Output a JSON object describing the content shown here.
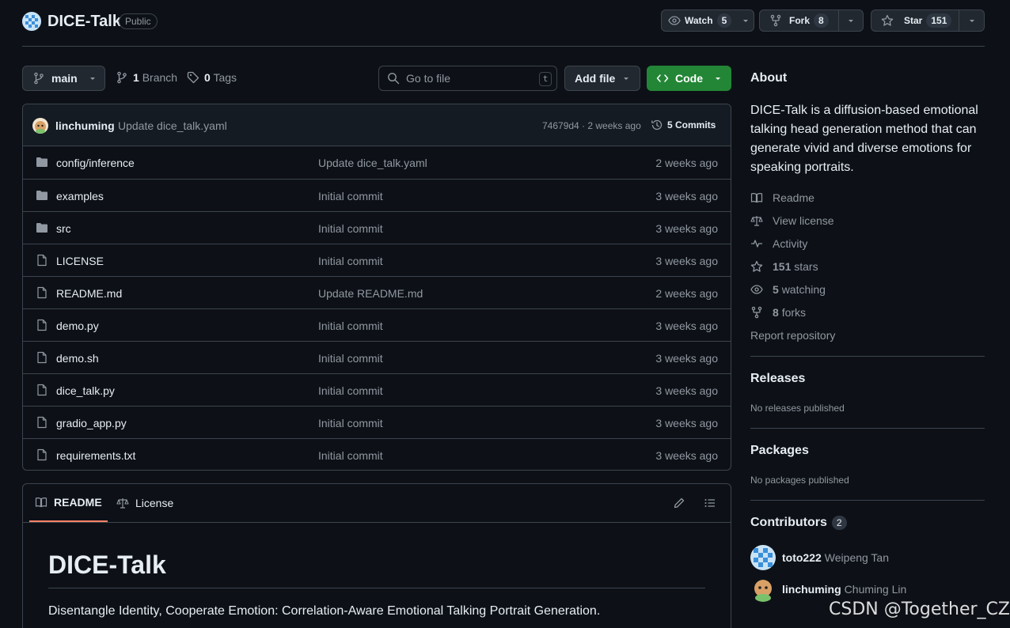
{
  "repo": {
    "name": "DICE-Talk",
    "visibility": "Public",
    "logo_icon": "pixel-avatar-icon"
  },
  "header_actions": {
    "watch": {
      "label": "Watch",
      "count": "5"
    },
    "fork": {
      "label": "Fork",
      "count": "8"
    },
    "star": {
      "label": "Star",
      "count": "151"
    }
  },
  "toolbar": {
    "branch": "main",
    "branches_count": "1",
    "branches_label": "Branch",
    "tags_count": "0",
    "tags_label": "Tags",
    "search_placeholder": "Go to file",
    "search_shortcut": "t",
    "add_file_label": "Add file",
    "code_label": "Code"
  },
  "latest_commit": {
    "author": "linchuming",
    "message": "Update dice_talk.yaml",
    "meta": "74679d4 · 2 weeks ago",
    "commits_label": "5 Commits"
  },
  "files": [
    {
      "type": "dir",
      "name": "config/inference",
      "commit": "Update dice_talk.yaml",
      "time": "2 weeks ago"
    },
    {
      "type": "dir",
      "name": "examples",
      "commit": "Initial commit",
      "time": "3 weeks ago"
    },
    {
      "type": "dir",
      "name": "src",
      "commit": "Initial commit",
      "time": "3 weeks ago"
    },
    {
      "type": "file",
      "name": "LICENSE",
      "commit": "Initial commit",
      "time": "3 weeks ago"
    },
    {
      "type": "file",
      "name": "README.md",
      "commit": "Update README.md",
      "time": "2 weeks ago"
    },
    {
      "type": "file",
      "name": "demo.py",
      "commit": "Initial commit",
      "time": "3 weeks ago"
    },
    {
      "type": "file",
      "name": "demo.sh",
      "commit": "Initial commit",
      "time": "3 weeks ago"
    },
    {
      "type": "file",
      "name": "dice_talk.py",
      "commit": "Initial commit",
      "time": "3 weeks ago"
    },
    {
      "type": "file",
      "name": "gradio_app.py",
      "commit": "Initial commit",
      "time": "3 weeks ago"
    },
    {
      "type": "file",
      "name": "requirements.txt",
      "commit": "Initial commit",
      "time": "3 weeks ago"
    }
  ],
  "readme": {
    "tab_readme": "README",
    "tab_license": "License",
    "title": "DICE-Talk",
    "subtitle": "Disentangle Identity, Cooperate Emotion: Correlation-Aware Emotional Talking Portrait Generation."
  },
  "about": {
    "title": "About",
    "description": "DICE-Talk is a diffusion-based emotional talking head generation method that can generate vivid and diverse emotions for speaking portraits.",
    "readme": "Readme",
    "license": "View license",
    "activity": "Activity",
    "stars_count": "151",
    "stars_label": "stars",
    "watching_count": "5",
    "watching_label": "watching",
    "forks_count": "8",
    "forks_label": "forks",
    "report": "Report repository"
  },
  "releases": {
    "title": "Releases",
    "empty": "No releases published"
  },
  "packages": {
    "title": "Packages",
    "empty": "No packages published"
  },
  "contributors": {
    "title": "Contributors",
    "count": "2",
    "list": [
      {
        "login": "toto222",
        "name": "Weipeng Tan"
      },
      {
        "login": "linchuming",
        "name": "Chuming Lin"
      }
    ]
  },
  "watermark": "CSDN @Together_CZ",
  "colors": {
    "background": "#0d1117",
    "border": "#3d444d",
    "code_button": "#238636",
    "active_tab": "#f78166"
  }
}
